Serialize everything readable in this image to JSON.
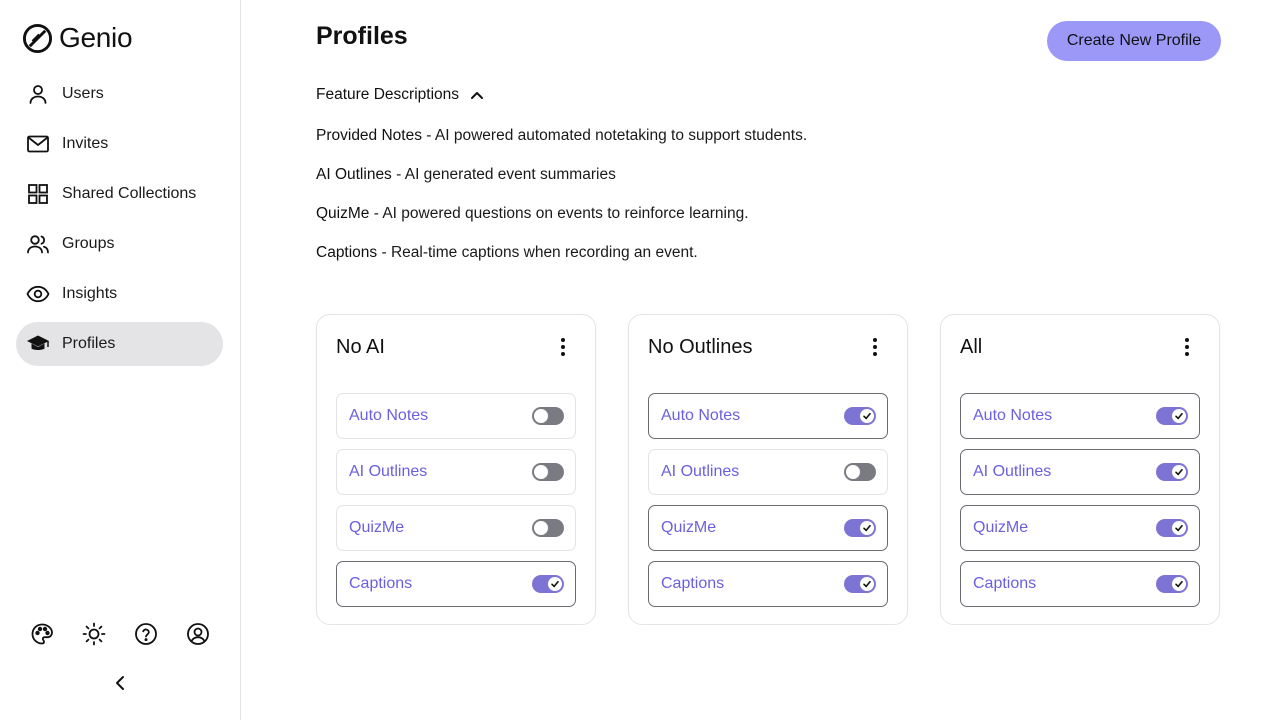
{
  "app": {
    "logo_text": "Genio"
  },
  "sidebar": {
    "items": [
      {
        "label": "Users",
        "icon": "user-icon"
      },
      {
        "label": "Invites",
        "icon": "mail-icon"
      },
      {
        "label": "Shared Collections",
        "icon": "grid-icon"
      },
      {
        "label": "Groups",
        "icon": "users-icon"
      },
      {
        "label": "Insights",
        "icon": "eye-icon"
      },
      {
        "label": "Profiles",
        "icon": "graduation-cap-icon",
        "active": true
      }
    ],
    "footer_icons": [
      "palette-icon",
      "sun-icon",
      "help-icon",
      "account-icon"
    ],
    "collapse_icon": "chevron-left-icon"
  },
  "main": {
    "title": "Profiles",
    "create_button": "Create New Profile",
    "feature_header": "Feature Descriptions",
    "descriptions": [
      {
        "name": "Provided Notes",
        "text": " - AI powered automated notetaking to support students."
      },
      {
        "name": "AI Outlines",
        "text": " - AI generated event summaries"
      },
      {
        "name": "QuizMe",
        "text": " - AI powered questions on events to reinforce learning."
      },
      {
        "name": "Captions",
        "text": " - Real-time captions when recording an event."
      }
    ],
    "profiles": [
      {
        "name": "No AI",
        "features": [
          {
            "label": "Auto Notes",
            "enabled": false
          },
          {
            "label": "AI Outlines",
            "enabled": false
          },
          {
            "label": "QuizMe",
            "enabled": false
          },
          {
            "label": "Captions",
            "enabled": true
          }
        ]
      },
      {
        "name": "No Outlines",
        "features": [
          {
            "label": "Auto Notes",
            "enabled": true
          },
          {
            "label": "AI Outlines",
            "enabled": false
          },
          {
            "label": "QuizMe",
            "enabled": true
          },
          {
            "label": "Captions",
            "enabled": true
          }
        ]
      },
      {
        "name": "All",
        "features": [
          {
            "label": "Auto Notes",
            "enabled": true
          },
          {
            "label": "AI Outlines",
            "enabled": true
          },
          {
            "label": "QuizMe",
            "enabled": true
          },
          {
            "label": "Captions",
            "enabled": true
          }
        ]
      }
    ]
  },
  "colors": {
    "accent_button": "#9c98f7",
    "toggle_on": "#7c73d4",
    "toggle_off": "#7a7a82",
    "feature_label": "#6a5fe0",
    "active_nav": "#e4e4e7"
  }
}
